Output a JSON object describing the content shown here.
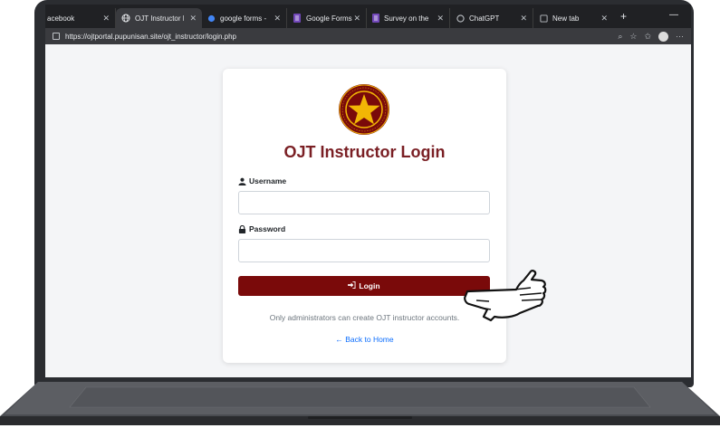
{
  "browser": {
    "tabs": [
      {
        "label": "acebook",
        "icon": "facebook-icon",
        "active": false
      },
      {
        "label": "OJT Instructor Log",
        "icon": "globe-icon",
        "active": true
      },
      {
        "label": "google forms - Sea",
        "icon": "search-icon",
        "active": false
      },
      {
        "label": "Google Forms",
        "icon": "forms-icon",
        "active": false
      },
      {
        "label": "Survey on the Dev",
        "icon": "forms-icon",
        "active": false
      },
      {
        "label": "ChatGPT",
        "icon": "chatgpt-icon",
        "active": false
      },
      {
        "label": "New tab",
        "icon": "newtab-icon",
        "active": false
      }
    ],
    "url": "https://ojtportal.pupunisan.site/ojt_instructor/login.php"
  },
  "login": {
    "title": "OJT Instructor Login",
    "username_label": "Username",
    "username_value": "",
    "password_label": "Password",
    "password_value": "",
    "login_button": "Login",
    "note": "Only administrators can create OJT instructor accounts.",
    "back_link": "Back to Home"
  },
  "colors": {
    "brand": "#7a1f24",
    "button": "#7a0a0a",
    "link": "#0d6efd",
    "seal_gold": "#f2b705",
    "seal_red": "#7a0a0a"
  }
}
